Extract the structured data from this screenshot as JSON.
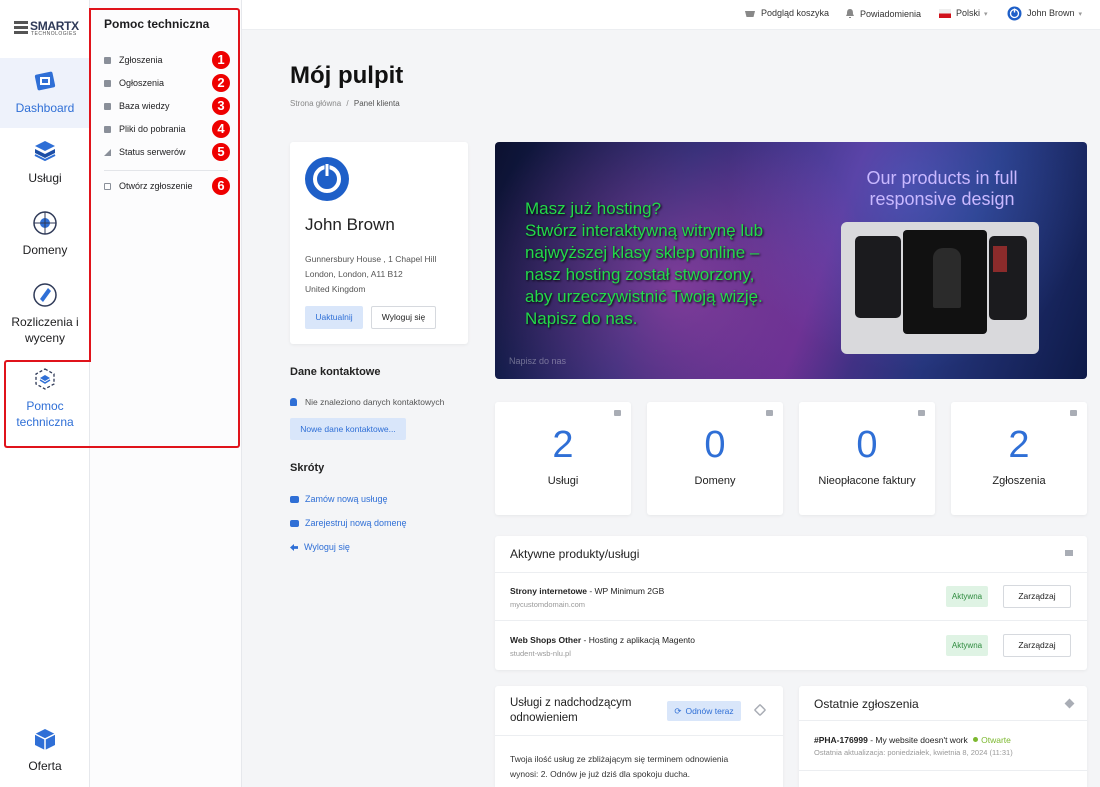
{
  "logo": {
    "main": "SMARTX",
    "sub": "TECHNOLOGIES"
  },
  "rail": {
    "items": [
      {
        "label_l1": "Dashboard",
        "label_l2": ""
      },
      {
        "label_l1": "Usługi",
        "label_l2": ""
      },
      {
        "label_l1": "Domeny",
        "label_l2": ""
      },
      {
        "label_l1": "Rozliczenia i",
        "label_l2": "wyceny"
      },
      {
        "label_l1": "Pomoc",
        "label_l2": "techniczna"
      },
      {
        "label_l1": "Oferta",
        "label_l2": ""
      }
    ]
  },
  "submenu": {
    "title": "Pomoc techniczna",
    "items": [
      {
        "label": "Zgłoszenia",
        "num": "1"
      },
      {
        "label": "Ogłoszenia",
        "num": "2"
      },
      {
        "label": "Baza wiedzy",
        "num": "3"
      },
      {
        "label": "Pliki do pobrania",
        "num": "4"
      },
      {
        "label": "Status serwerów",
        "num": "5"
      },
      {
        "label": "Otwórz zgłoszenie",
        "num": "6"
      }
    ]
  },
  "topbar": {
    "cart": "Podgląd koszyka",
    "notifications": "Powiadomienia",
    "language": "Polski",
    "user": "John Brown"
  },
  "page": {
    "title": "Mój pulpit",
    "breadcrumb_home": "Strona główna",
    "breadcrumb_sep": "/",
    "breadcrumb_current": "Panel klienta"
  },
  "profile": {
    "name": "John Brown",
    "addr1": "Gunnersbury House , 1 Chapel Hill",
    "addr2": "London, London, A11 B12",
    "addr3": "United Kingdom",
    "update": "Uaktualnij",
    "logout": "Wyloguj się"
  },
  "contacts": {
    "heading": "Dane kontaktowe",
    "empty": "Nie znaleziono danych kontaktowych",
    "new_btn": "Nowe dane kontaktowe..."
  },
  "shortcuts": {
    "heading": "Skróty",
    "items": [
      "Zamów nową usługę",
      "Zarejestruj nową domenę",
      "Wyloguj się"
    ]
  },
  "banner": {
    "lines": [
      "Masz już hosting?",
      "Stwórz interaktywną witrynę lub",
      "najwyższej klasy sklep online –",
      "nasz hosting został stworzony,",
      "aby urzeczywistnić Twoją wizję.",
      "Napisz do nas."
    ],
    "right_title": "Our products in full responsive design",
    "watermark": "Napisz do nas",
    "colors": {
      "green": "#23d94a",
      "right": "#c9b8ff"
    }
  },
  "stats": [
    {
      "value": "2",
      "label": "Usługi"
    },
    {
      "value": "0",
      "label": "Domeny"
    },
    {
      "value": "0",
      "label": "Nieopłacone faktury"
    },
    {
      "value": "2",
      "label": "Zgłoszenia"
    }
  ],
  "active": {
    "heading": "Aktywne produkty/usługi",
    "rows": [
      {
        "name": "Strony internetowe",
        "plan": " - WP Minimum 2GB",
        "domain": "mycustomdomain.com",
        "status": "Aktywna",
        "action": "Zarządzaj"
      },
      {
        "name": "Web Shops Other",
        "plan": " - Hosting z aplikacją Magento",
        "domain": "student-wsb-nlu.pl",
        "status": "Aktywna",
        "action": "Zarządzaj"
      }
    ]
  },
  "renewals": {
    "heading_l1": "Usługi z nadchodzącym",
    "heading_l2": "odnowieniem",
    "btn": "Odnów teraz",
    "text_l1": "Twoja ilość usług ze zbliżającym się terminem odnowienia",
    "text_l2": "wynosi: 2. Odnów je już dziś dla spokoju ducha."
  },
  "tickets": {
    "heading": "Ostatnie zgłoszenia",
    "items": [
      {
        "id": "#PHA-176999",
        "subject": " - My website doesn't work",
        "status": "Otwarte",
        "updated": "Ostatnia aktualizacja: poniedziałek, kwietnia 8, 2024 (11:31)"
      }
    ]
  },
  "accent": "#2f6fd6"
}
